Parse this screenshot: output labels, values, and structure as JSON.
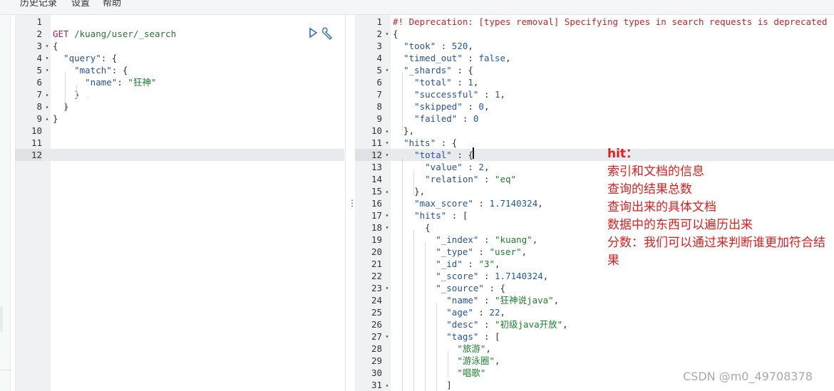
{
  "menu": {
    "history": "历史记录",
    "settings": "设置",
    "help": "帮助"
  },
  "request": {
    "lines": [
      {
        "n": "1",
        "segs": []
      },
      {
        "n": "2",
        "segs": [
          [
            "method",
            "GET"
          ],
          [
            "pun",
            " "
          ],
          [
            "url",
            "/kuang/user/_search"
          ]
        ]
      },
      {
        "n": "3",
        "fold": "▾",
        "segs": [
          [
            "pun",
            "{"
          ]
        ]
      },
      {
        "n": "4",
        "fold": "▾",
        "segs": [
          [
            "pun",
            "  "
          ],
          [
            "key",
            "\"query\""
          ],
          [
            "pun",
            ": {"
          ]
        ]
      },
      {
        "n": "5",
        "fold": "▾",
        "segs": [
          [
            "pun",
            "    "
          ],
          [
            "key",
            "\"match\""
          ],
          [
            "pun",
            ": {"
          ]
        ]
      },
      {
        "n": "6",
        "segs": [
          [
            "pun",
            "      "
          ],
          [
            "key",
            "\"name\""
          ],
          [
            "pun",
            ": "
          ],
          [
            "str",
            "\"狂神\""
          ]
        ]
      },
      {
        "n": "7",
        "fold": "▴",
        "segs": [
          [
            "pun",
            "    }"
          ]
        ]
      },
      {
        "n": "8",
        "fold": "▴",
        "segs": [
          [
            "pun",
            "  }"
          ]
        ]
      },
      {
        "n": "9",
        "fold": "▴",
        "segs": [
          [
            "pun",
            "}"
          ]
        ]
      },
      {
        "n": "10",
        "segs": []
      },
      {
        "n": "11",
        "segs": []
      },
      {
        "n": "12",
        "segs": [],
        "active": true
      }
    ]
  },
  "response": {
    "lines": [
      {
        "n": "1",
        "segs": [
          [
            "warn",
            "#! Deprecation: [types removal] Specifying types in search requests is deprecated"
          ]
        ]
      },
      {
        "n": "2",
        "fold": "▾",
        "segs": [
          [
            "pun",
            "{"
          ]
        ]
      },
      {
        "n": "3",
        "segs": [
          [
            "pun",
            "  "
          ],
          [
            "key",
            "\"took\""
          ],
          [
            "pun",
            " : "
          ],
          [
            "num",
            "520"
          ],
          [
            "pun",
            ","
          ]
        ]
      },
      {
        "n": "4",
        "segs": [
          [
            "pun",
            "  "
          ],
          [
            "key",
            "\"timed_out\""
          ],
          [
            "pun",
            " : "
          ],
          [
            "kw",
            "false"
          ],
          [
            "pun",
            ","
          ]
        ]
      },
      {
        "n": "5",
        "fold": "▾",
        "segs": [
          [
            "pun",
            "  "
          ],
          [
            "key",
            "\"_shards\""
          ],
          [
            "pun",
            " : {"
          ]
        ]
      },
      {
        "n": "6",
        "segs": [
          [
            "pun",
            "    "
          ],
          [
            "key",
            "\"total\""
          ],
          [
            "pun",
            " : "
          ],
          [
            "num",
            "1"
          ],
          [
            "pun",
            ","
          ]
        ]
      },
      {
        "n": "7",
        "segs": [
          [
            "pun",
            "    "
          ],
          [
            "key",
            "\"successful\""
          ],
          [
            "pun",
            " : "
          ],
          [
            "num",
            "1"
          ],
          [
            "pun",
            ","
          ]
        ]
      },
      {
        "n": "8",
        "segs": [
          [
            "pun",
            "    "
          ],
          [
            "key",
            "\"skipped\""
          ],
          [
            "pun",
            " : "
          ],
          [
            "num",
            "0"
          ],
          [
            "pun",
            ","
          ]
        ]
      },
      {
        "n": "9",
        "segs": [
          [
            "pun",
            "    "
          ],
          [
            "key",
            "\"failed\""
          ],
          [
            "pun",
            " : "
          ],
          [
            "num",
            "0"
          ]
        ]
      },
      {
        "n": "10",
        "fold": "▴",
        "segs": [
          [
            "pun",
            "  },"
          ]
        ]
      },
      {
        "n": "11",
        "fold": "▾",
        "segs": [
          [
            "pun",
            "  "
          ],
          [
            "key",
            "\"hits\""
          ],
          [
            "pun",
            " : {"
          ]
        ]
      },
      {
        "n": "12",
        "fold": "▾",
        "segs": [
          [
            "pun",
            "    "
          ],
          [
            "key",
            "\"total\""
          ],
          [
            "pun",
            " : {"
          ]
        ],
        "active": true
      },
      {
        "n": "13",
        "segs": [
          [
            "pun",
            "      "
          ],
          [
            "key",
            "\"value\""
          ],
          [
            "pun",
            " : "
          ],
          [
            "num",
            "2"
          ],
          [
            "pun",
            ","
          ]
        ]
      },
      {
        "n": "14",
        "segs": [
          [
            "pun",
            "      "
          ],
          [
            "key",
            "\"relation\""
          ],
          [
            "pun",
            " : "
          ],
          [
            "str",
            "\"eq\""
          ]
        ]
      },
      {
        "n": "15",
        "fold": "▴",
        "segs": [
          [
            "pun",
            "    },"
          ]
        ]
      },
      {
        "n": "16",
        "segs": [
          [
            "pun",
            "    "
          ],
          [
            "key",
            "\"max_score\""
          ],
          [
            "pun",
            " : "
          ],
          [
            "num",
            "1.7140324"
          ],
          [
            "pun",
            ","
          ]
        ]
      },
      {
        "n": "17",
        "fold": "▾",
        "segs": [
          [
            "pun",
            "    "
          ],
          [
            "key",
            "\"hits\""
          ],
          [
            "pun",
            " : ["
          ]
        ]
      },
      {
        "n": "18",
        "fold": "▾",
        "segs": [
          [
            "pun",
            "      {"
          ]
        ]
      },
      {
        "n": "19",
        "segs": [
          [
            "pun",
            "        "
          ],
          [
            "key",
            "\"_index\""
          ],
          [
            "pun",
            " : "
          ],
          [
            "str",
            "\"kuang\""
          ],
          [
            "pun",
            ","
          ]
        ]
      },
      {
        "n": "20",
        "segs": [
          [
            "pun",
            "        "
          ],
          [
            "key",
            "\"_type\""
          ],
          [
            "pun",
            " : "
          ],
          [
            "str",
            "\"user\""
          ],
          [
            "pun",
            ","
          ]
        ]
      },
      {
        "n": "21",
        "segs": [
          [
            "pun",
            "        "
          ],
          [
            "key",
            "\"_id\""
          ],
          [
            "pun",
            " : "
          ],
          [
            "str",
            "\"3\""
          ],
          [
            "pun",
            ","
          ]
        ]
      },
      {
        "n": "22",
        "segs": [
          [
            "pun",
            "        "
          ],
          [
            "key",
            "\"_score\""
          ],
          [
            "pun",
            " : "
          ],
          [
            "num",
            "1.7140324"
          ],
          [
            "pun",
            ","
          ]
        ]
      },
      {
        "n": "23",
        "fold": "▾",
        "segs": [
          [
            "pun",
            "        "
          ],
          [
            "key",
            "\"_source\""
          ],
          [
            "pun",
            " : {"
          ]
        ]
      },
      {
        "n": "24",
        "segs": [
          [
            "pun",
            "          "
          ],
          [
            "key",
            "\"name\""
          ],
          [
            "pun",
            " : "
          ],
          [
            "str",
            "\"狂神说java\""
          ],
          [
            "pun",
            ","
          ]
        ]
      },
      {
        "n": "25",
        "segs": [
          [
            "pun",
            "          "
          ],
          [
            "key",
            "\"age\""
          ],
          [
            "pun",
            " : "
          ],
          [
            "num",
            "22"
          ],
          [
            "pun",
            ","
          ]
        ]
      },
      {
        "n": "26",
        "segs": [
          [
            "pun",
            "          "
          ],
          [
            "key",
            "\"desc\""
          ],
          [
            "pun",
            " : "
          ],
          [
            "str",
            "\"初级java开放\""
          ],
          [
            "pun",
            ","
          ]
        ]
      },
      {
        "n": "27",
        "fold": "▾",
        "segs": [
          [
            "pun",
            "          "
          ],
          [
            "key",
            "\"tags\""
          ],
          [
            "pun",
            " : ["
          ]
        ]
      },
      {
        "n": "28",
        "segs": [
          [
            "pun",
            "            "
          ],
          [
            "str",
            "\"旅游\""
          ],
          [
            "pun",
            ","
          ]
        ]
      },
      {
        "n": "29",
        "segs": [
          [
            "pun",
            "            "
          ],
          [
            "str",
            "\"游泳圈\""
          ],
          [
            "pun",
            ","
          ]
        ]
      },
      {
        "n": "30",
        "segs": [
          [
            "pun",
            "            "
          ],
          [
            "str",
            "\"唱歌\""
          ]
        ]
      },
      {
        "n": "31",
        "fold": "▴",
        "segs": [
          [
            "pun",
            "          ]"
          ]
        ]
      }
    ]
  },
  "annotation": {
    "title": "hit：",
    "items": [
      "索引和文档的信息",
      "查询的结果总数",
      "查询出来的具体文档",
      "数据中的东西可以遍历出来",
      "分数：我们可以通过来判断谁更加符合结果"
    ]
  },
  "watermark": "CSDN @m0_49708378",
  "icons": {
    "run": "play-icon",
    "settings": "wrench-icon",
    "resize": "vertical-dots-icon"
  },
  "colors": {
    "warning": "#c3242b",
    "annotation": "#e11d1d",
    "key": "#27529b",
    "string": "#1a7f2b"
  }
}
